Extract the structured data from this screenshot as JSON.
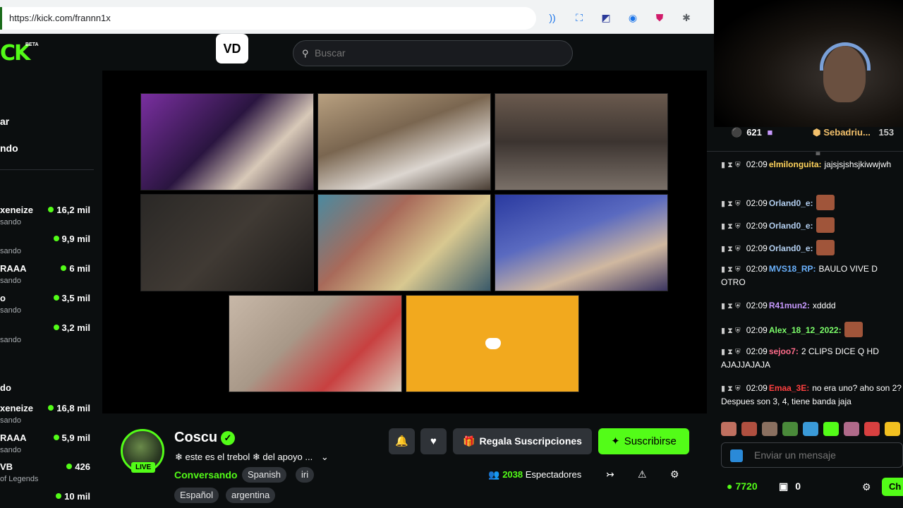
{
  "browser": {
    "url": "https://kick.com/frannn1x"
  },
  "header": {
    "logo_text": "CK",
    "logo_badge": "BETA",
    "vd_label": "VD",
    "search_placeholder": "Buscar"
  },
  "sidebar": {
    "nav": [
      "ar",
      "ndo"
    ],
    "channels": [
      {
        "name": "xeneize",
        "sub": "sando",
        "viewers": "16,2 mil"
      },
      {
        "name": "",
        "sub": "sando",
        "viewers": "9,9 mil"
      },
      {
        "name": "RAAA",
        "sub": "sando",
        "viewers": "6 mil"
      },
      {
        "name": "o",
        "sub": "sando",
        "viewers": "3,5 mil"
      },
      {
        "name": "",
        "sub": "sando",
        "viewers": "3,2 mil"
      },
      {
        "name": "do",
        "sub": "",
        "viewers": ""
      },
      {
        "name": "xeneize",
        "sub": "sando",
        "viewers": "16,8 mil"
      },
      {
        "name": "RAAA",
        "sub": "sando",
        "viewers": "5,9 mil"
      },
      {
        "name": "VB",
        "sub": "of Legends",
        "viewers": "426"
      },
      {
        "name": "",
        "sub": "",
        "viewers": "10 mil"
      }
    ]
  },
  "video": {
    "tile_colors": [
      "#5b2d7a",
      "#6b5a45",
      "#5a4a3f",
      "#2e2a26",
      "#5d6b7a",
      "#2f3c6e",
      "#b8a48e",
      "#f2a91e"
    ],
    "discord_tile_color": "#f2a91e"
  },
  "channel": {
    "name": "Coscu",
    "live_label": "LIVE",
    "stream_title": "❄ este es el trebol ❄ del apoyo ...",
    "category": "Conversando",
    "tags": [
      "Spanish",
      "iri",
      "Español",
      "argentina"
    ],
    "gift_label": "Regala Suscripciones",
    "subscribe_label": "Suscribirse",
    "viewer_count": "2038",
    "viewer_label": "Espectadores"
  },
  "chat": {
    "top_stats": {
      "left_count": "621",
      "user": "Sebadriu...",
      "user_count": "153"
    },
    "messages": [
      {
        "time": "02:09",
        "user": "elmilonguita:",
        "color": "#ffd35c",
        "text": "jajsjsjshsjkiwwjwh",
        "emote": false
      },
      {
        "time": "02:09",
        "user": "Orland0_e:",
        "color": "#b3cff0",
        "text": "",
        "emote": true
      },
      {
        "time": "02:09",
        "user": "Orland0_e:",
        "color": "#b3cff0",
        "text": "",
        "emote": true
      },
      {
        "time": "02:09",
        "user": "Orland0_e:",
        "color": "#b3cff0",
        "text": "",
        "emote": true
      },
      {
        "time": "02:09",
        "user": "MVS18_RP:",
        "color": "#6bb3ff",
        "text": "BAULO VIVE D OTRO",
        "emote": false
      },
      {
        "time": "02:09",
        "user": "R41mun2:",
        "color": "#c89aff",
        "text": "xdddd",
        "emote": false
      },
      {
        "time": "02:09",
        "user": "Alex_18_12_2022:",
        "color": "#7dff6b",
        "text": "",
        "emote": true
      },
      {
        "time": "02:09",
        "user": "sejoo7:",
        "color": "#ff6b8a",
        "text": "2 CLIPS DICE Q HD AJAJJAJAJA",
        "emote": false
      },
      {
        "time": "02:09",
        "user": "Emaa_3E:",
        "color": "#ff4040",
        "text": "no era uno? aho son 2? Despues son 3, 4, tiene banda jaja",
        "emote": false
      }
    ],
    "input_placeholder": "Enviar un mensaje",
    "points": "7720",
    "tickets": "0",
    "send_label": "Ch"
  }
}
